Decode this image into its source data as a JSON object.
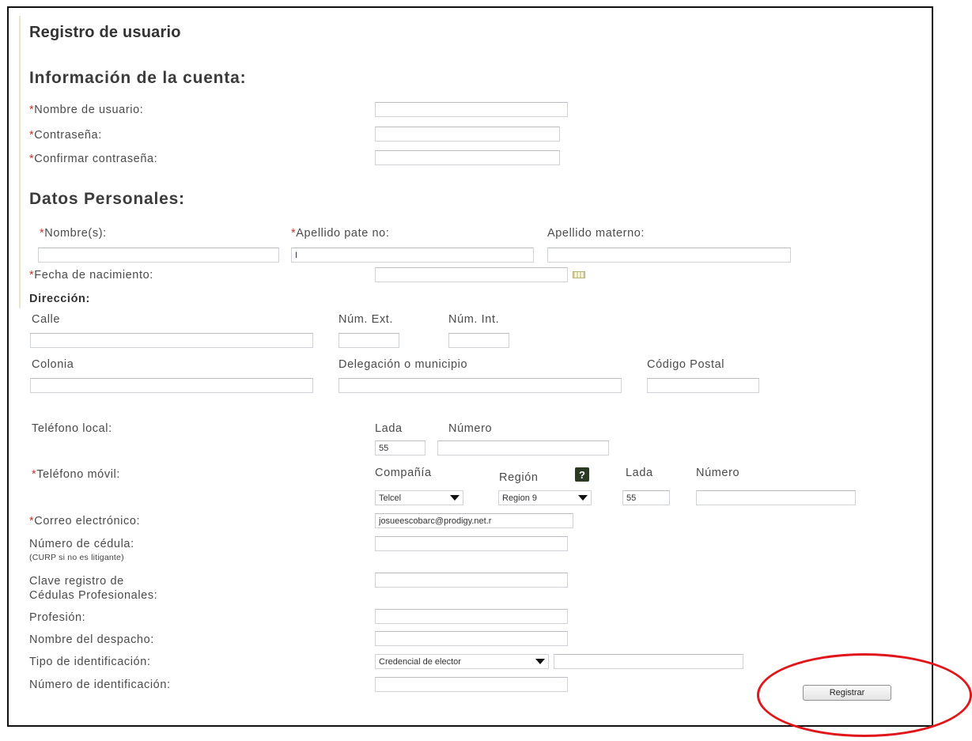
{
  "page": {
    "title": "Registro de usuario",
    "colors": {
      "required_marker": "#c0392b",
      "callout": "#e0161b",
      "help_icon_bg": "#2b3a22"
    }
  },
  "account": {
    "heading": "Información de la cuenta:",
    "username_label": "Nombre de usuario:",
    "password_label": "Contraseña:",
    "confirm_password_label": "Confirmar contraseña:",
    "username_value": "",
    "password_value": "",
    "confirm_password_value": ""
  },
  "personal": {
    "heading": "Datos Personales:",
    "first_name_label": "Nombre(s):",
    "paternal_label": "Apellido pate no:",
    "maternal_label": "Apellido materno:",
    "paternal_value": "I",
    "birthdate_label": "Fecha de nacimiento:",
    "calendar_icon": "calendar-icon"
  },
  "address": {
    "heading": "Dirección:",
    "street_label": "Calle",
    "ext_num_label": "Núm. Ext.",
    "int_num_label": "Núm. Int.",
    "colonia_label": "Colonia",
    "municipio_label": "Delegación o municipio",
    "postal_label": "Código Postal"
  },
  "phones": {
    "local_label": "Teléfono local:",
    "lada_label": "Lada",
    "numero_label": "Número",
    "local_lada_value": "55",
    "mobile_label": "Teléfono móvil:",
    "company_label": "Compañía",
    "region_label": "Región",
    "help_glyph": "?",
    "mobile_lada_label": "Lada",
    "mobile_numero_label": "Número",
    "company_value": "Telcel",
    "region_value": "Region 9",
    "mobile_lada_value": "55"
  },
  "contact": {
    "email_label": "Correo electrónico:",
    "email_value": "josueescobarc@prodigy.net.r",
    "cedula_label": "Número de cédula:",
    "cedula_hint": "(CURP si no es litigante)",
    "clave_label_1": "Clave registro de",
    "clave_label_2": "Cédulas Profesionales:",
    "profesion_label": "Profesión:",
    "despacho_label": "Nombre del despacho:",
    "id_type_label": "Tipo de identificación:",
    "id_type_value": "Credencial de elector",
    "id_number_label": "Número de identificación:"
  },
  "actions": {
    "submit_label": "Registrar"
  }
}
